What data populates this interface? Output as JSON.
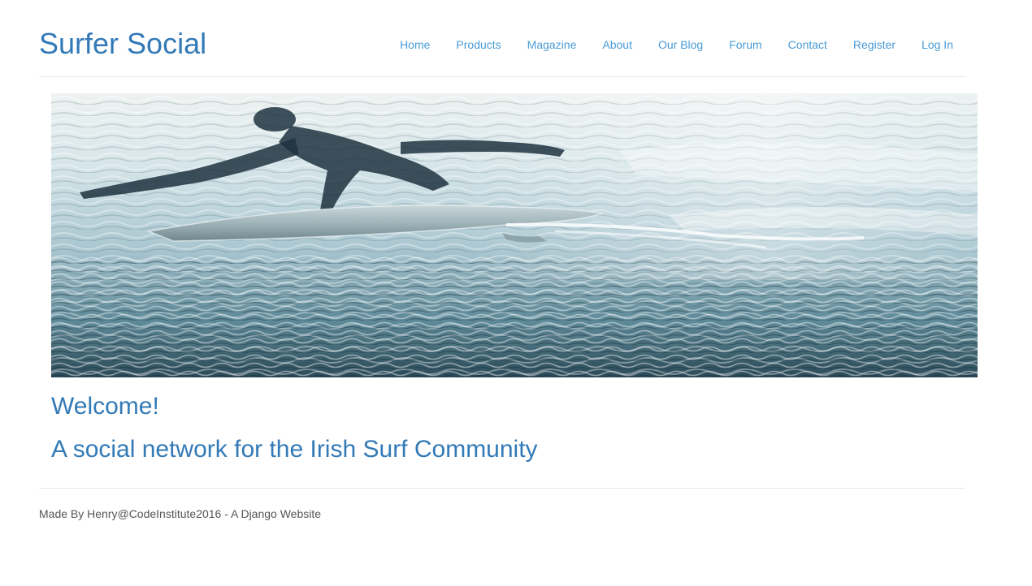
{
  "brand": {
    "title": "Surfer Social"
  },
  "nav": {
    "items": [
      {
        "label": "Home"
      },
      {
        "label": "Products"
      },
      {
        "label": "Magazine"
      },
      {
        "label": "About"
      },
      {
        "label": "Our Blog"
      },
      {
        "label": "Forum"
      },
      {
        "label": "Contact"
      },
      {
        "label": "Register"
      },
      {
        "label": "Log In"
      }
    ]
  },
  "hero": {
    "image_description": "surfer-paddling-underwater-view"
  },
  "main": {
    "welcome": "Welcome!",
    "tagline": "A social network for the Irish Surf Community"
  },
  "footer": {
    "credit": "Made By Henry@CodeInstitute2016 - A Django Website"
  },
  "colors": {
    "brand": "#337ab7",
    "nav_link": "#4a9bd6",
    "divider": "#e6e6e6",
    "footer_text": "#555555"
  }
}
